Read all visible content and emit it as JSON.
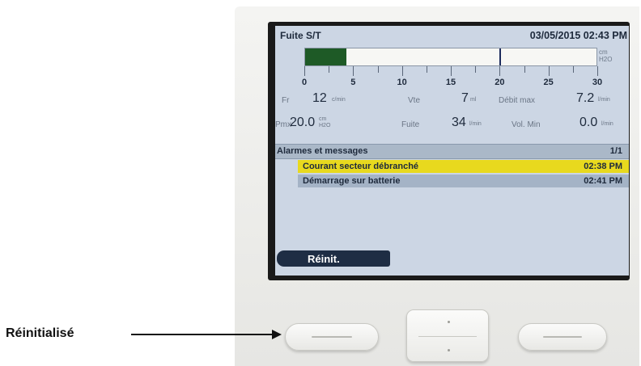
{
  "screen": {
    "mode": "Fuite S/T",
    "datetime": "03/05/2015 02:43 PM",
    "bar": {
      "unit_top": "cm",
      "unit_bottom": "H2O",
      "value": 4.2,
      "marker": 20,
      "min": 0,
      "max": 30,
      "tick_labels": [
        "0",
        "5",
        "10",
        "15",
        "20",
        "25",
        "30"
      ]
    },
    "row1": {
      "fr_label": "Fr",
      "fr_value": "12",
      "fr_unit": "c/min",
      "vte_label": "Vte",
      "vte_value": "7",
      "vte_unit": "ml",
      "debit_label": "Débit max",
      "debit_value": "7.2",
      "debit_unit": "l/min"
    },
    "row2": {
      "pmx_label": "Pmx",
      "pmx_value": "20.0",
      "pmx_unit_top": "cm",
      "pmx_unit_bottom": "H2O",
      "fuite_label": "Fuite",
      "fuite_value": "34",
      "fuite_unit": "l/min",
      "volmin_label": "Vol. Min",
      "volmin_value": "0.0",
      "volmin_unit": "l/min"
    },
    "alarms": {
      "title": "Alarmes et messages",
      "page": "1/1",
      "items": [
        {
          "text": "Courant secteur débranché",
          "time": "02:38 PM"
        },
        {
          "text": "Démarrage sur batterie",
          "time": "02:41 PM"
        }
      ]
    },
    "softkey_label": "Réinit."
  },
  "callout": {
    "label": "Réinitialisé"
  },
  "colors": {
    "screen_bg": "#ccd6e4",
    "bar_fill": "#1e5a26",
    "alarm_highlight": "#e8d91e",
    "softkey_bg": "#1e2d44"
  }
}
